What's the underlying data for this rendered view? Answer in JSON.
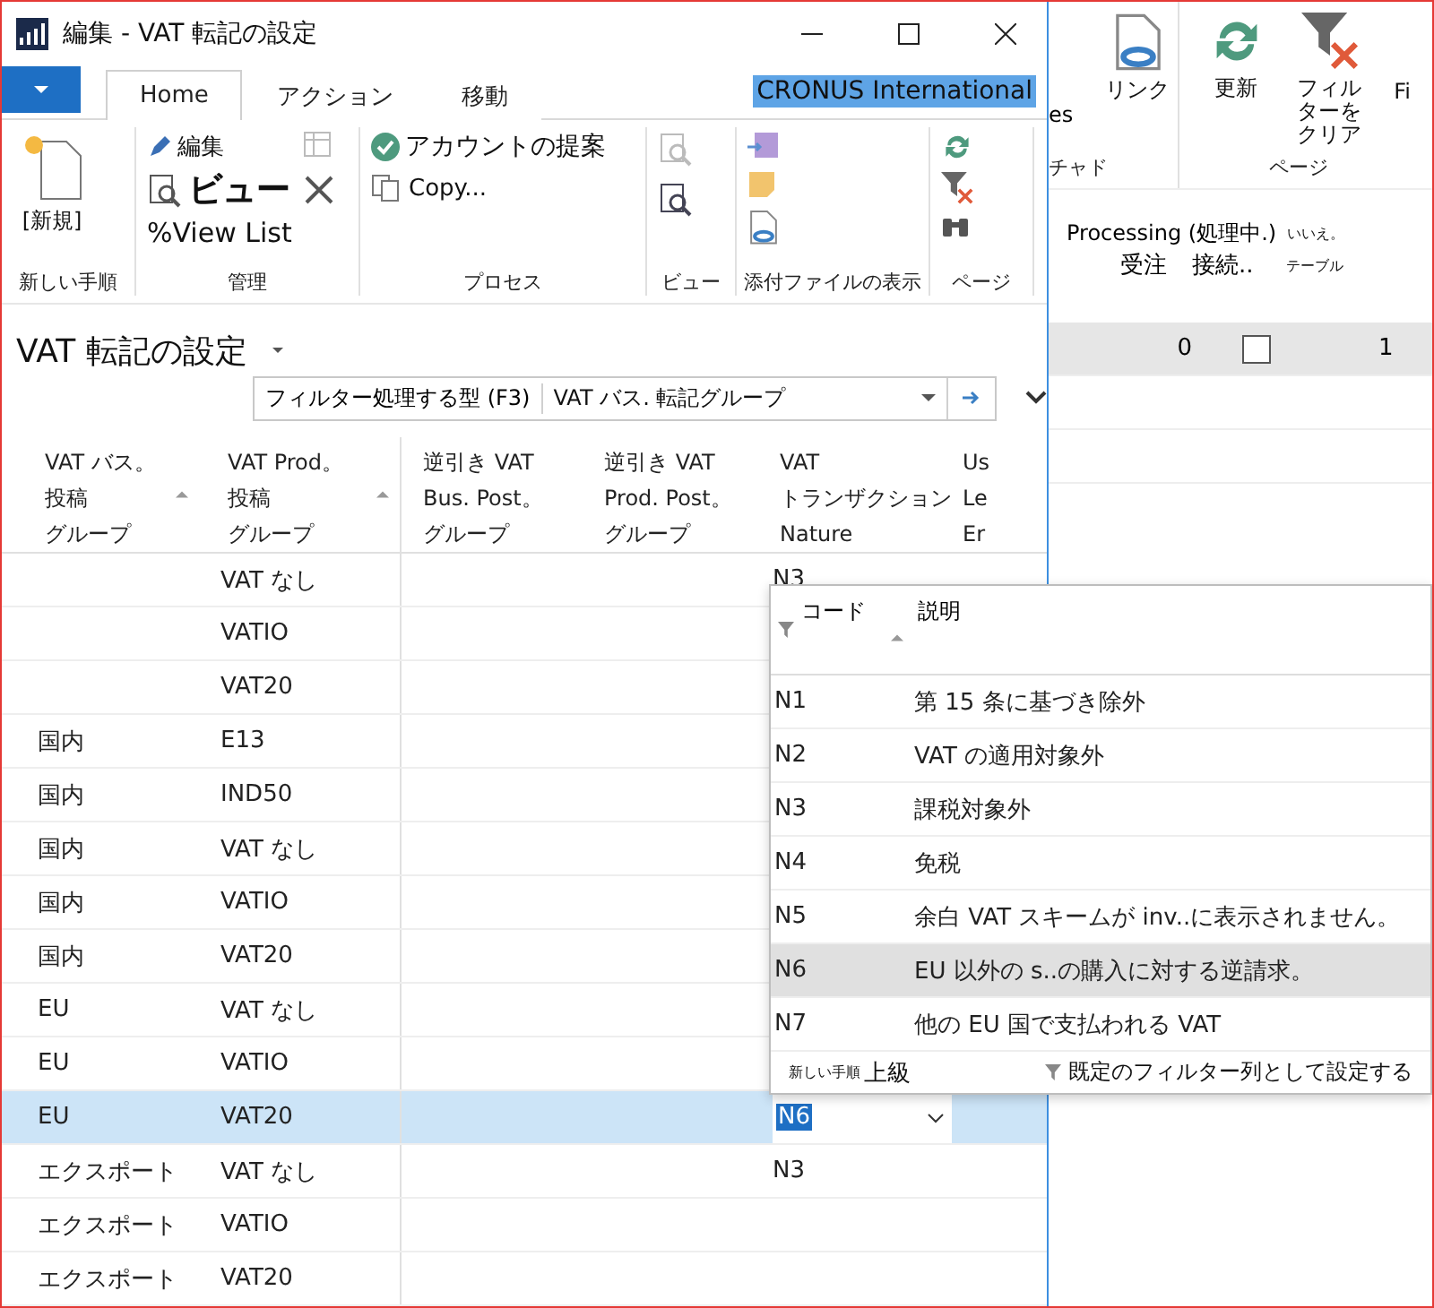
{
  "window": {
    "title": "編集 - VAT 転記の設定",
    "company": "CRONUS International"
  },
  "ribbon_tabs": [
    {
      "label": "Home",
      "selected": true
    },
    {
      "label": "アクション",
      "selected": false
    },
    {
      "label": "移動",
      "selected": false
    }
  ],
  "ribbon_groups": [
    {
      "label": "新しい手順",
      "items": [
        "[新規]"
      ]
    },
    {
      "label": "管理",
      "items": [
        "編集",
        "ビュー",
        "%View List"
      ]
    },
    {
      "label": "プロセス",
      "items": [
        "アカウントの提案",
        "Copy..."
      ]
    },
    {
      "label": "ビュー"
    },
    {
      "label": "添付ファイルの表示"
    },
    {
      "label": "ページ"
    }
  ],
  "page": {
    "title": "VAT 転記の設定",
    "filter_type": "フィルター処理する型 (F3)",
    "filter_field": "VAT バス. 転記グループ"
  },
  "columns": [
    {
      "lines": [
        "VAT バス。",
        "投稿",
        "グループ"
      ],
      "sortable": true
    },
    {
      "lines": [
        "VAT Prod。",
        "投稿",
        "グループ"
      ],
      "sortable": true
    },
    {
      "lines": [
        "逆引き VAT",
        "Bus. Post。",
        "グループ"
      ]
    },
    {
      "lines": [
        "逆引き VAT",
        "Prod. Post。",
        "グループ"
      ]
    },
    {
      "lines": [
        "VAT",
        "トランザクション",
        "Nature"
      ]
    },
    {
      "lines": [
        "Us",
        "Le",
        "Er"
      ]
    }
  ],
  "rows": [
    {
      "prod": "VAT なし",
      "nature": "N3",
      "selected": false
    },
    {
      "prod": "VATIO",
      "selected": false
    },
    {
      "prod": "VAT20",
      "selected": false
    },
    {
      "bus": "国内",
      "prod": "E13",
      "selected": false
    },
    {
      "bus": "国内",
      "prod": "IND50",
      "selected": false
    },
    {
      "bus": "国内",
      "prod": "VAT なし",
      "selected": false
    },
    {
      "bus": "国内",
      "prod": "VATIO",
      "selected": false
    },
    {
      "bus": "国内",
      "prod": "VAT20",
      "selected": false
    },
    {
      "bus": "EU",
      "prod": "VAT なし",
      "selected": false
    },
    {
      "bus": "EU",
      "prod": "VATIO",
      "selected": false
    },
    {
      "bus": "EU",
      "prod": "VAT20",
      "nature": "N6",
      "selected": true
    },
    {
      "bus": "エクスポート",
      "prod": "VAT なし",
      "nature": "N3",
      "selected": false
    },
    {
      "bus": "エクスポート",
      "prod": "VATIO",
      "selected": false
    },
    {
      "bus": "エクスポート",
      "prod": "VAT20",
      "selected": false
    }
  ],
  "lookup": {
    "columns": [
      "コード",
      "説明"
    ],
    "rows": [
      {
        "code": "N1",
        "description": "第 15 条に基づき除外",
        "selected": false
      },
      {
        "code": "N2",
        "description": "VAT の適用対象外",
        "selected": false
      },
      {
        "code": "N3",
        "description": "課税対象外",
        "selected": false
      },
      {
        "code": "N4",
        "description": "免税",
        "selected": false
      },
      {
        "code": "N5",
        "description": "余白 VAT スキームが inv..に表示されません。",
        "selected": false
      },
      {
        "code": "N6",
        "description": "EU 以外の s..の購入に対する逆請求。",
        "selected": true
      },
      {
        "code": "N7",
        "description": "他の EU 国で支払われる VAT",
        "selected": false
      }
    ],
    "footer_new": "新しい手順",
    "footer_advanced": "上級",
    "footer_filter": "既定のフィルター列として設定する"
  },
  "back_window": {
    "ribbon_items": [
      "es",
      "リンク",
      "更新",
      "フィルターをクリア",
      "Fi"
    ],
    "groups": [
      "チャド",
      "ページ"
    ],
    "header_group": "Processing (処理中.)",
    "columns": [
      "受注",
      "接続..",
      "いいえ。",
      "テーブル"
    ],
    "row": {
      "order": "0",
      "connected": false,
      "column_3": "1"
    }
  }
}
